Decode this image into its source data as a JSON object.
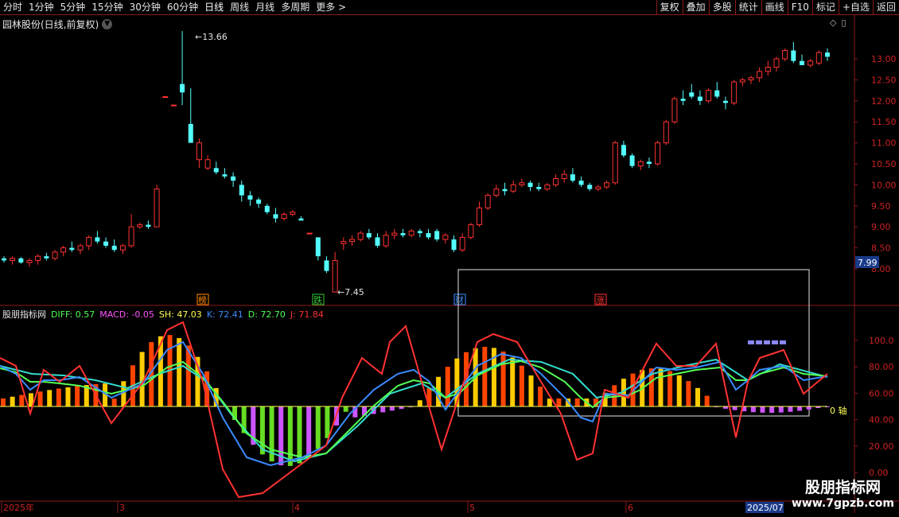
{
  "toolbar": {
    "periods": [
      "分时",
      "1分钟",
      "5分钟",
      "15分钟",
      "30分钟",
      "60分钟",
      "日线",
      "周线",
      "月线",
      "多周期",
      "更多 >"
    ],
    "active_period": "日线",
    "right_buttons": [
      "复权",
      "叠加",
      "多股",
      "统计",
      "画线",
      "F10",
      "标记",
      "+自选",
      "返回"
    ]
  },
  "stock": {
    "title": "园林股份(日线,前复权)",
    "high_label": "13.66",
    "low_label": "7.45",
    "current_price": "7.99",
    "event_markers": [
      "榜",
      "跌",
      "财",
      "涨"
    ]
  },
  "price_axis": [
    "13.00",
    "12.50",
    "12.00",
    "11.50",
    "11.00",
    "10.50",
    "10.00",
    "9.50",
    "9.00",
    "8.50",
    "8.00"
  ],
  "indicator": {
    "name": "股朋指标网",
    "diff": "DIFF: 0.57",
    "macd": "MACD: -0.05",
    "sh": "SH: 47.03",
    "k": "K: 72.41",
    "d": "D: 72.70",
    "j": "J: 71.84",
    "axis": [
      "100.0",
      "80.00",
      "60.00",
      "40.00",
      "20.00",
      "0.00"
    ],
    "zero_axis_label": "0 轴"
  },
  "date_axis": {
    "labels": [
      "2025年",
      "3",
      "4",
      "5",
      "6"
    ],
    "current": "2025/07"
  },
  "watermark": {
    "title": "股朋指标网",
    "url": "www.7gpzb.com"
  },
  "colors": {
    "up": "#ff3232",
    "down": "#54ffff",
    "grid_border": "#8b1a1a",
    "diff": "#54ff54",
    "macd": "#ff54ff",
    "sh": "#ffff54",
    "k": "#3a8bff",
    "d": "#54ff54",
    "j": "#ff3232"
  },
  "chart_data": {
    "type": "candlestick",
    "price_range": [
      7.45,
      13.66
    ],
    "candles_ohlc": [
      [
        8.25,
        8.3,
        8.15,
        8.2
      ],
      [
        8.2,
        8.3,
        8.1,
        8.25
      ],
      [
        8.25,
        8.28,
        8.12,
        8.15
      ],
      [
        8.15,
        8.25,
        8.05,
        8.2
      ],
      [
        8.2,
        8.35,
        8.1,
        8.3
      ],
      [
        8.3,
        8.38,
        8.2,
        8.25
      ],
      [
        8.25,
        8.45,
        8.2,
        8.4
      ],
      [
        8.4,
        8.55,
        8.3,
        8.5
      ],
      [
        8.5,
        8.65,
        8.4,
        8.45
      ],
      [
        8.45,
        8.6,
        8.35,
        8.55
      ],
      [
        8.55,
        8.8,
        8.45,
        8.75
      ],
      [
        8.75,
        8.9,
        8.6,
        8.65
      ],
      [
        8.65,
        8.75,
        8.5,
        8.55
      ],
      [
        8.55,
        8.7,
        8.4,
        8.45
      ],
      [
        8.45,
        8.6,
        8.35,
        8.55
      ],
      [
        8.55,
        9.3,
        8.5,
        9.0
      ],
      [
        9.0,
        9.1,
        8.95,
        9.05
      ],
      [
        9.05,
        9.15,
        8.95,
        9.0
      ],
      [
        9.0,
        10.0,
        9.0,
        9.9
      ],
      [
        12.1,
        12.1,
        12.1,
        12.1
      ],
      [
        11.9,
        11.9,
        11.9,
        11.9
      ],
      [
        12.4,
        13.66,
        11.9,
        12.2
      ],
      [
        11.45,
        12.3,
        11.4,
        11.0
      ],
      [
        10.6,
        11.1,
        10.4,
        11.0
      ],
      [
        10.4,
        10.7,
        10.35,
        10.6
      ],
      [
        10.4,
        10.55,
        10.25,
        10.3
      ],
      [
        10.25,
        10.4,
        10.15,
        10.2
      ],
      [
        10.2,
        10.3,
        9.95,
        10.1
      ],
      [
        10.0,
        10.1,
        9.6,
        9.75
      ],
      [
        9.75,
        9.85,
        9.5,
        9.65
      ],
      [
        9.65,
        9.7,
        9.45,
        9.55
      ],
      [
        9.5,
        9.55,
        9.3,
        9.35
      ],
      [
        9.3,
        9.45,
        9.1,
        9.2
      ],
      [
        9.2,
        9.35,
        9.15,
        9.3
      ],
      [
        9.3,
        9.4,
        9.25,
        9.35
      ],
      [
        9.2,
        9.25,
        9.15,
        9.15
      ],
      [
        8.85,
        8.85,
        8.85,
        8.85
      ],
      [
        8.75,
        8.75,
        8.2,
        8.3
      ],
      [
        8.2,
        8.3,
        7.9,
        7.95
      ],
      [
        7.45,
        8.4,
        7.45,
        8.2
      ],
      [
        8.6,
        8.75,
        8.45,
        8.65
      ],
      [
        8.65,
        8.8,
        8.55,
        8.7
      ],
      [
        8.7,
        8.9,
        8.65,
        8.85
      ],
      [
        8.85,
        8.95,
        8.7,
        8.75
      ],
      [
        8.75,
        8.85,
        8.5,
        8.55
      ],
      [
        8.55,
        8.9,
        8.5,
        8.8
      ],
      [
        8.8,
        8.95,
        8.7,
        8.85
      ],
      [
        8.85,
        8.95,
        8.75,
        8.8
      ],
      [
        8.8,
        8.95,
        8.75,
        8.9
      ],
      [
        8.9,
        8.95,
        8.75,
        8.85
      ],
      [
        8.85,
        8.95,
        8.7,
        8.75
      ],
      [
        8.9,
        8.95,
        8.65,
        8.7
      ],
      [
        8.7,
        8.85,
        8.6,
        8.8
      ],
      [
        8.7,
        8.8,
        8.4,
        8.45
      ],
      [
        8.45,
        8.85,
        8.4,
        8.75
      ],
      [
        8.75,
        9.1,
        8.7,
        9.05
      ],
      [
        9.05,
        9.6,
        9.0,
        9.45
      ],
      [
        9.45,
        9.8,
        9.4,
        9.75
      ],
      [
        9.75,
        10.0,
        9.7,
        9.9
      ],
      [
        9.9,
        10.05,
        9.75,
        9.85
      ],
      [
        9.85,
        10.1,
        9.8,
        10.0
      ],
      [
        10.0,
        10.15,
        9.95,
        10.05
      ],
      [
        10.05,
        10.1,
        9.85,
        9.95
      ],
      [
        9.95,
        10.05,
        9.85,
        9.9
      ],
      [
        9.9,
        10.05,
        9.85,
        10.0
      ],
      [
        10.0,
        10.25,
        9.95,
        10.15
      ],
      [
        10.15,
        10.35,
        10.05,
        10.25
      ],
      [
        10.25,
        10.4,
        10.05,
        10.1
      ],
      [
        10.1,
        10.2,
        9.95,
        10.0
      ],
      [
        10.0,
        10.05,
        9.85,
        9.9
      ],
      [
        9.9,
        10.0,
        9.85,
        9.95
      ],
      [
        9.95,
        10.1,
        9.9,
        10.05
      ],
      [
        10.05,
        11.05,
        10.0,
        11.0
      ],
      [
        10.95,
        11.05,
        10.65,
        10.7
      ],
      [
        10.7,
        10.75,
        10.4,
        10.45
      ],
      [
        10.45,
        10.6,
        10.35,
        10.55
      ],
      [
        10.55,
        10.65,
        10.4,
        10.5
      ],
      [
        10.5,
        11.05,
        10.45,
        11.0
      ],
      [
        11.0,
        11.55,
        10.95,
        11.5
      ],
      [
        11.5,
        12.1,
        11.45,
        12.05
      ],
      [
        12.05,
        12.25,
        11.9,
        12.0
      ],
      [
        12.2,
        12.4,
        12.05,
        12.1
      ],
      [
        12.1,
        12.25,
        11.9,
        12.0
      ],
      [
        12.0,
        12.3,
        11.95,
        12.25
      ],
      [
        12.25,
        12.45,
        12.05,
        12.1
      ],
      [
        12.0,
        12.1,
        11.8,
        11.95
      ],
      [
        11.95,
        12.5,
        11.9,
        12.45
      ],
      [
        12.45,
        12.55,
        12.35,
        12.5
      ],
      [
        12.5,
        12.6,
        12.4,
        12.55
      ],
      [
        12.55,
        12.8,
        12.45,
        12.7
      ],
      [
        12.7,
        12.95,
        12.6,
        12.8
      ],
      [
        12.8,
        13.05,
        12.7,
        13.0
      ],
      [
        13.0,
        13.25,
        12.95,
        13.2
      ],
      [
        13.2,
        13.4,
        12.9,
        12.95
      ],
      [
        12.95,
        13.1,
        12.9,
        12.85
      ],
      [
        12.85,
        13.0,
        12.8,
        12.95
      ],
      [
        12.9,
        13.2,
        12.85,
        13.15
      ],
      [
        13.15,
        13.25,
        12.95,
        13.05
      ]
    ],
    "macd_hist_count": 90,
    "kdj_range": [
      0,
      100
    ]
  }
}
